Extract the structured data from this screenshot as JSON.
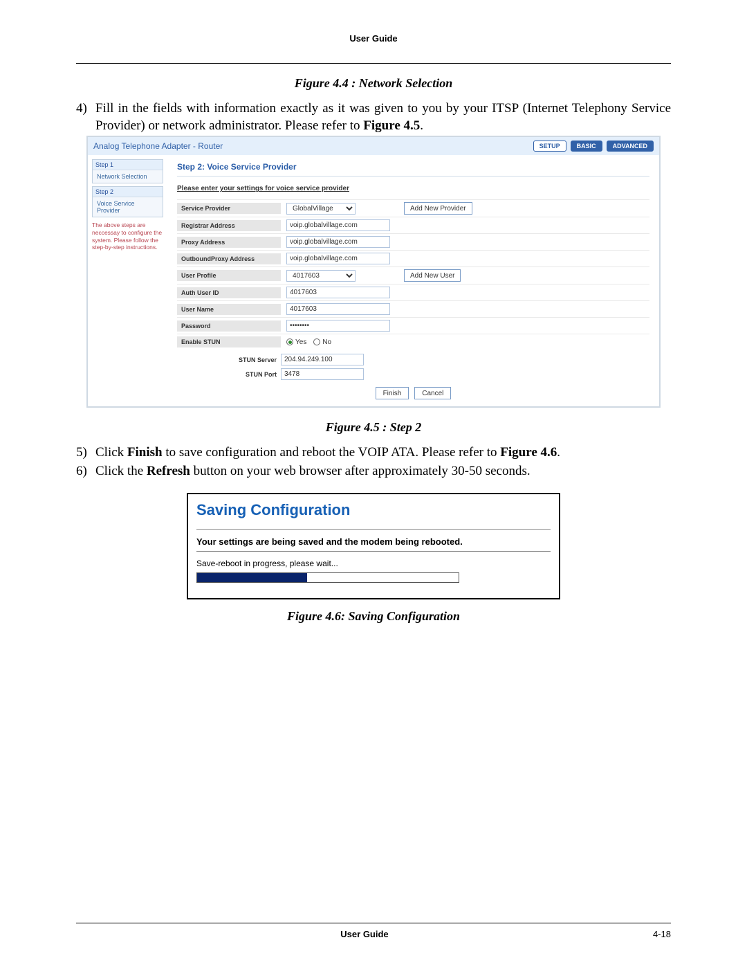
{
  "header": {
    "title": "User Guide"
  },
  "caption1": "Figure 4.4 : Network Selection",
  "step4": {
    "num": "4)",
    "text_a": "Fill in the fields with information exactly as it was given to you by your ITSP (Internet Telephony Service Provider) or network administrator. Please refer to ",
    "bold": "Figure 4.5",
    "text_b": "."
  },
  "router": {
    "brand": "Analog Telephone Adapter - Router",
    "tabs": {
      "setup": "SETUP",
      "basic": "BASIC",
      "advanced": "ADVANCED"
    },
    "side": {
      "step1": "Step 1",
      "step1_item": "Network Selection",
      "step2": "Step 2",
      "step2_item": "Voice Service Provider",
      "note": "The above steps are neccessay to configure the system. Please follow the step-by-step instructions."
    },
    "form": {
      "title": "Step 2: Voice Service Provider",
      "instruction": "Please enter your settings for voice service provider",
      "labels": {
        "provider": "Service Provider",
        "registrar": "Registrar Address",
        "proxy": "Proxy Address",
        "outproxy": "OutboundProxy Address",
        "userprofile": "User Profile",
        "authuser": "Auth User ID",
        "username": "User Name",
        "password": "Password",
        "stun": "Enable STUN",
        "stunserver": "STUN Server",
        "stunport": "STUN Port"
      },
      "values": {
        "provider_option": "GlobalVillage",
        "registrar": "voip.globalvillage.com",
        "proxy": "voip.globalvillage.com",
        "outproxy": "voip.globalvillage.com",
        "userprofile": "4017603",
        "authuser": "4017603",
        "username": "4017603",
        "password": "••••••••",
        "stun_yes": "Yes",
        "stun_no": "No",
        "stunserver": "204.94.249.100",
        "stunport": "3478"
      },
      "buttons": {
        "add_provider": "Add New Provider",
        "add_user": "Add New User",
        "finish": "Finish",
        "cancel": "Cancel"
      }
    }
  },
  "caption2": "Figure 4.5 : Step 2",
  "step5": {
    "num": "5)",
    "a": "Click ",
    "b": "Finish",
    "c": " to save configuration and reboot the VOIP ATA. Please refer to ",
    "d": "Figure 4.6",
    "e": "."
  },
  "step6": {
    "num": "6)",
    "a": "Click the ",
    "b": "Refresh",
    "c": " button on your web browser after approximately 30-50 seconds."
  },
  "save": {
    "title": "Saving Configuration",
    "msg": "Your settings are being saved and the modem being rebooted.",
    "sub": "Save-reboot in progress, please wait..."
  },
  "caption3": "Figure 4.6: Saving Configuration",
  "footer": {
    "title": "User Guide",
    "page": "4-18"
  }
}
